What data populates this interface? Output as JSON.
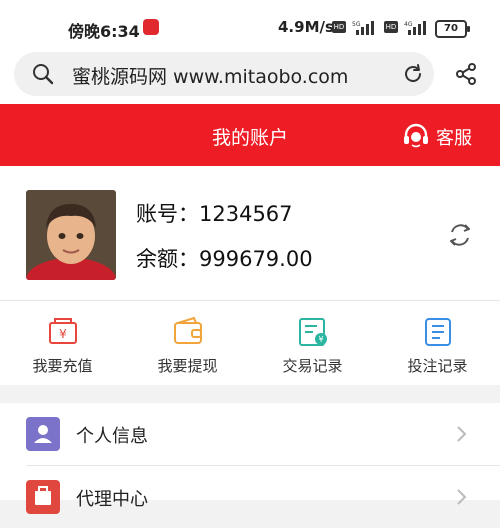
{
  "status_bar": {
    "time": "傍晚6:34",
    "net_speed": "4.9M/s",
    "hd1": "HD",
    "sig1": "5G",
    "hd2": "HD",
    "sig2": "4G",
    "battery": "70"
  },
  "browser": {
    "url": "蜜桃源码网 www.mitaobo.com",
    "icons": [
      "search-icon",
      "reload-icon",
      "share-icon"
    ]
  },
  "header": {
    "title": "我的账户",
    "service_label": "客服",
    "bg_color": "#ee1c25"
  },
  "account": {
    "account_label": "账号：",
    "account_value": "1234567",
    "balance_label": "余额：",
    "balance_value": "999679.00"
  },
  "actions": [
    {
      "label": "我要充值",
      "icon": "recharge-icon",
      "color": "#e8453c"
    },
    {
      "label": "我要提现",
      "icon": "wallet-icon",
      "color": "#f0a43a"
    },
    {
      "label": "交易记录",
      "icon": "transaction-record-icon",
      "color": "#2bb5a0"
    },
    {
      "label": "投注记录",
      "icon": "bet-record-icon",
      "color": "#3a8ee6"
    }
  ],
  "menu": [
    {
      "label": "个人信息",
      "icon": "user-icon",
      "color": "#7b72c9"
    },
    {
      "label": "代理中心",
      "icon": "agent-icon",
      "color": "#e0473f"
    }
  ]
}
